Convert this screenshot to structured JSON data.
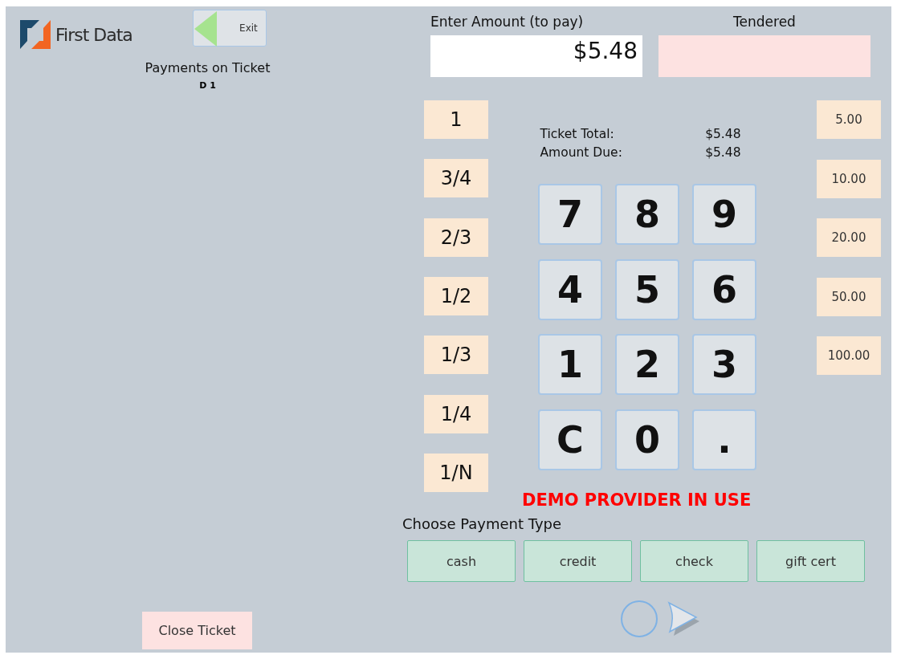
{
  "brand": {
    "name": "First Data"
  },
  "exit_button": {
    "label": "Exit"
  },
  "ticket": {
    "title": "Payments on Ticket",
    "id": "D 1"
  },
  "amount": {
    "label": "Enter Amount (to pay)",
    "value": "$5.48"
  },
  "tendered": {
    "label": "Tendered"
  },
  "fractions": [
    "1",
    "3/4",
    "2/3",
    "1/2",
    "1/3",
    "1/4",
    "1/N"
  ],
  "summary": [
    {
      "label": "Ticket Total:",
      "value": "$5.48"
    },
    {
      "label": "Amount Due:",
      "value": "$5.48"
    }
  ],
  "keypad": [
    "7",
    "8",
    "9",
    "4",
    "5",
    "6",
    "1",
    "2",
    "3",
    "C",
    "0",
    "."
  ],
  "denominations": [
    "5.00",
    "10.00",
    "20.00",
    "50.00",
    "100.00"
  ],
  "notice": "DEMO PROVIDER IN USE",
  "payment": {
    "label": "Choose Payment Type",
    "types": [
      "cash",
      "credit",
      "check",
      "gift cert"
    ]
  },
  "close_button": {
    "label": "Close Ticket"
  }
}
